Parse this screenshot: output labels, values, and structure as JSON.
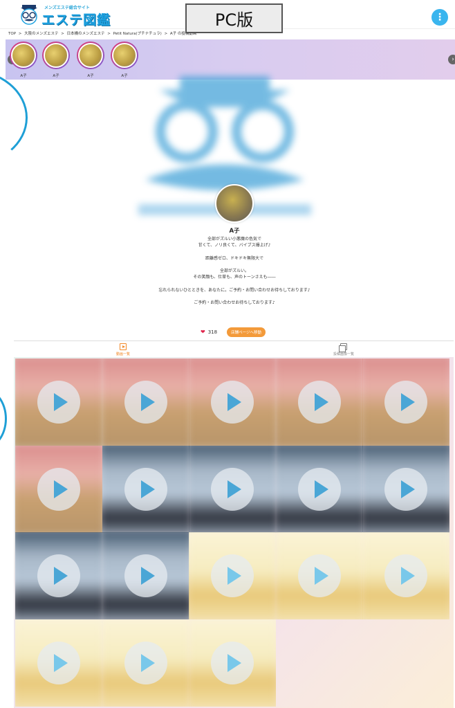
{
  "header": {
    "logo_tagline": "メンズエステ総合サイト",
    "logo_text": "エステ図鑑",
    "pc_button_label": "PC版",
    "menu_icon": "⋮"
  },
  "breadcrumb": [
    "TOP",
    ">",
    "大阪のメンズエステ",
    ">",
    "日本橋のメンズエステ",
    ">",
    "Petit Natura(プチナチュラ)",
    ">",
    "A子 の投稿動画"
  ],
  "stories": [
    {
      "name": "A子"
    },
    {
      "name": "A子"
    },
    {
      "name": "A子"
    },
    {
      "name": "A子"
    }
  ],
  "story_scroll": {
    "prev_icon": "‹",
    "next_icon": "›"
  },
  "profile": {
    "name": "A子",
    "bio_lines": [
      "全部がズルい小悪魔の色気で",
      "甘くて、ノリ良くて、バイブス爆上げ♪",
      "",
      "距離感ゼロ、ドキドキ無限大で",
      "",
      "全部がズルい。",
      "その笑顔も、仕草も、声のトーンさえも――",
      "",
      "忘れられないひとときを、あなたに。ご予約・お問い合わせお待ちしております♪",
      "",
      "ご予約・お問い合わせお待ちしております♪"
    ],
    "likes": "318",
    "detail_button": "店舗ページへ移動"
  },
  "tabs": [
    {
      "label": "動画一覧",
      "icon": "video-icon",
      "active": true
    },
    {
      "label": "投稿画像一覧",
      "icon": "photo-icon",
      "active": false
    }
  ],
  "colors": {
    "accent_blue": "#1da1e0",
    "accent_orange": "#f28a2a",
    "heart_red": "#e0264c",
    "play_blue": "#4aa6d6"
  },
  "video_tiles": [
    {
      "theme": "pink"
    },
    {
      "theme": "pink"
    },
    {
      "theme": "pink"
    },
    {
      "theme": "pink"
    },
    {
      "theme": "pink"
    },
    {
      "theme": "pink"
    },
    {
      "theme": "blue"
    },
    {
      "theme": "blue"
    },
    {
      "theme": "blue"
    },
    {
      "theme": "blue"
    },
    {
      "theme": "blue"
    },
    {
      "theme": "blue"
    },
    {
      "theme": "yellow"
    },
    {
      "theme": "yellow"
    },
    {
      "theme": "yellow"
    },
    {
      "theme": "yellow"
    },
    {
      "theme": "yellow"
    },
    {
      "theme": "yellow"
    }
  ]
}
